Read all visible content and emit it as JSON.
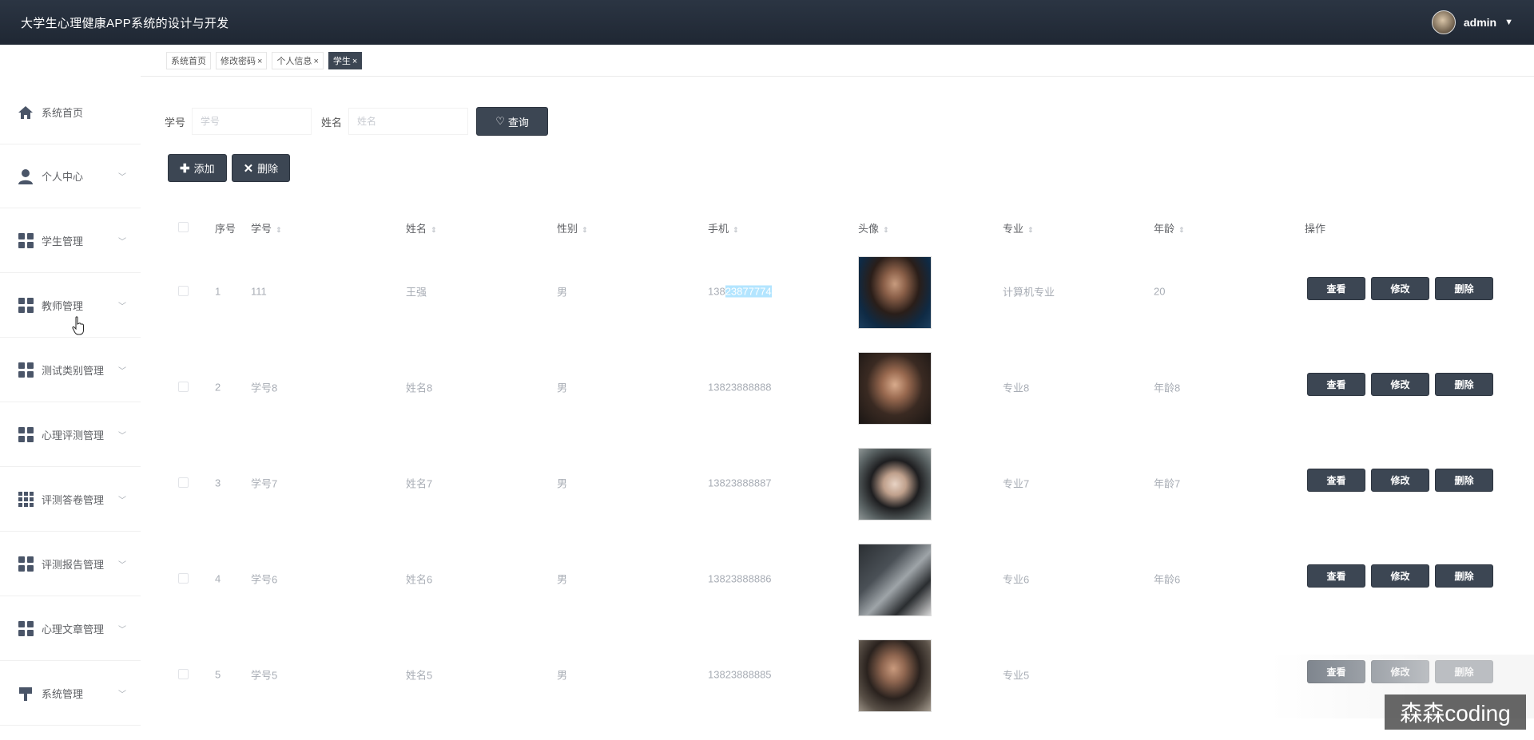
{
  "header": {
    "title": "大学生心理健康APP系统的设计与开发",
    "username": "admin"
  },
  "tabs": [
    {
      "label": "系统首页",
      "closable": false
    },
    {
      "label": "修改密码",
      "closable": true
    },
    {
      "label": "个人信息",
      "closable": true
    },
    {
      "label": "学生",
      "closable": true,
      "active": true
    }
  ],
  "sidebar": {
    "items": [
      {
        "label": "系统首页",
        "icon": "home-icon"
      },
      {
        "label": "个人中心",
        "icon": "user-icon"
      },
      {
        "label": "学生管理",
        "icon": "grid-icon"
      },
      {
        "label": "教师管理",
        "icon": "grid-icon"
      },
      {
        "label": "测试类别管理",
        "icon": "grid-icon"
      },
      {
        "label": "心理评测管理",
        "icon": "grid-icon"
      },
      {
        "label": "评测答卷管理",
        "icon": "apps-icon"
      },
      {
        "label": "评测报告管理",
        "icon": "grid-icon"
      },
      {
        "label": "心理文章管理",
        "icon": "grid-icon"
      },
      {
        "label": "系统管理",
        "icon": "pin-icon"
      }
    ]
  },
  "search": {
    "xuehao_label": "学号",
    "xuehao_placeholder": "学号",
    "xingming_label": "姓名",
    "xingming_placeholder": "姓名",
    "query_label": "查询"
  },
  "actions": {
    "add_label": "添加",
    "delete_label": "删除"
  },
  "table": {
    "columns": [
      "序号",
      "学号",
      "姓名",
      "性别",
      "手机",
      "头像",
      "专业",
      "年龄",
      "操作"
    ],
    "rows": [
      {
        "index": "1",
        "xuehao": "111",
        "xingming": "王强",
        "xingbie": "男",
        "shouji_a": "138",
        "shouji_b": "23877774",
        "zhuanye": "计算机专业",
        "nianling": "20"
      },
      {
        "index": "2",
        "xuehao": "学号8",
        "xingming": "姓名8",
        "xingbie": "男",
        "shouji_a": "13823888888",
        "shouji_b": "",
        "zhuanye": "专业8",
        "nianling": "年龄8"
      },
      {
        "index": "3",
        "xuehao": "学号7",
        "xingming": "姓名7",
        "xingbie": "男",
        "shouji_a": "13823888887",
        "shouji_b": "",
        "zhuanye": "专业7",
        "nianling": "年龄7"
      },
      {
        "index": "4",
        "xuehao": "学号6",
        "xingming": "姓名6",
        "xingbie": "男",
        "shouji_a": "13823888886",
        "shouji_b": "",
        "zhuanye": "专业6",
        "nianling": "年龄6"
      },
      {
        "index": "5",
        "xuehao": "学号5",
        "xingming": "姓名5",
        "xingbie": "男",
        "shouji_a": "13823888885",
        "shouji_b": "",
        "zhuanye": "专业5",
        "nianling": ""
      }
    ],
    "row_actions": {
      "view": "查看",
      "edit": "修改",
      "delete": "删除"
    }
  },
  "watermark": "森森coding",
  "colors": {
    "header_bg": "#1f2733",
    "button_dark": "#3c4653",
    "highlight": "#b3e5ff"
  }
}
